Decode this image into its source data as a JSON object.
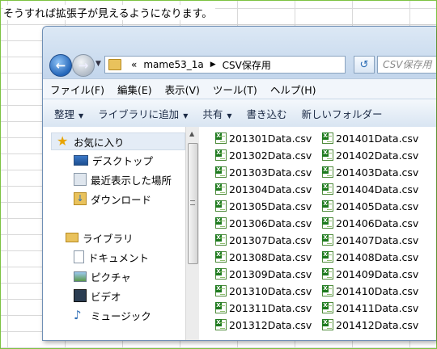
{
  "intro_text": "そうすれば拡張子が見えるようになります。",
  "window": {
    "address": {
      "parent": "mame53_1a",
      "current": "CSV保存用",
      "overflow": "«"
    },
    "search_placeholder": "CSV保存用",
    "menu": [
      "ファイル(F)",
      "編集(E)",
      "表示(V)",
      "ツール(T)",
      "ヘルプ(H)"
    ],
    "toolbar": [
      {
        "label": "整理",
        "dropdown": true
      },
      {
        "label": "ライブラリに追加",
        "dropdown": true
      },
      {
        "label": "共有",
        "dropdown": true
      },
      {
        "label": "書き込む",
        "dropdown": false
      },
      {
        "label": "新しいフォルダー",
        "dropdown": false
      }
    ],
    "nav": {
      "favorites": "お気に入り",
      "favorite_items": [
        "デスクトップ",
        "最近表示した場所",
        "ダウンロード"
      ],
      "libraries": "ライブラリ",
      "library_items": [
        "ドキュメント",
        "ピクチャ",
        "ビデオ",
        "ミュージック"
      ]
    },
    "files_col1": [
      "201301Data.csv",
      "201302Data.csv",
      "201303Data.csv",
      "201304Data.csv",
      "201305Data.csv",
      "201306Data.csv",
      "201307Data.csv",
      "201308Data.csv",
      "201309Data.csv",
      "201310Data.csv",
      "201311Data.csv",
      "201312Data.csv"
    ],
    "files_col2": [
      "201401Data.csv",
      "201402Data.csv",
      "201403Data.csv",
      "201404Data.csv",
      "201405Data.csv",
      "201406Data.csv",
      "201407Data.csv",
      "201408Data.csv",
      "201409Data.csv",
      "201410Data.csv",
      "201411Data.csv",
      "201412Data.csv"
    ]
  }
}
